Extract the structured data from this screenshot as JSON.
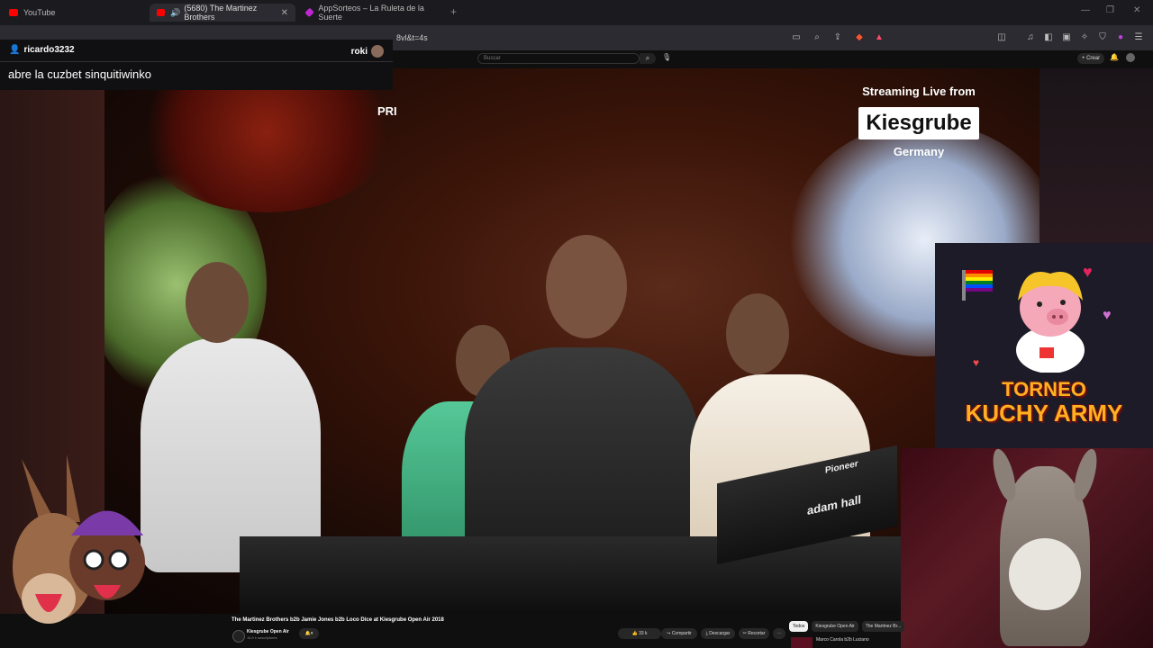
{
  "browser": {
    "tabs": [
      {
        "label": "YouTube",
        "color": "#ff0000"
      },
      {
        "label": "(5680) The Martinez Brothers",
        "color": "#ff0000"
      },
      {
        "label": "AppSorteos – La Ruleta de la Suerte",
        "color": "#c026d3"
      }
    ],
    "url_visible": "8vl&t=4s"
  },
  "youtube": {
    "search_placeholder": "Buscar",
    "create_label": "+ Crear",
    "video_title": "The Martinez Brothers b2b Jamie Jones b2b Loco Dice at Kiesgrube Open Air 2018",
    "channel_name": "Kiesgrube Open Air",
    "channel_subs": "16,9 k suscriptores",
    "like_count": "33 k",
    "share_label": "Compartir",
    "download_label": "Descargar",
    "clip_label": "Recortar",
    "chips": [
      "Todos",
      "Kiesgrube Open Air",
      "The Martinez Br..."
    ],
    "related_title": "Marco Carola b2b Luciano"
  },
  "chat": {
    "username": "ricardo3232",
    "right_user": "roki",
    "message": "abre la cuzbet sinquitiwinko"
  },
  "overlay": {
    "streaming_text": "Streaming Live from",
    "logo_text": "Kiesgrube",
    "country": "Germany",
    "pr_text": "PRI",
    "torneo_line1": "TORNEO",
    "torneo_line2": "KUCHY ARMY",
    "equipment_brand": "Pioneer",
    "adam_hall": "adam hall"
  }
}
